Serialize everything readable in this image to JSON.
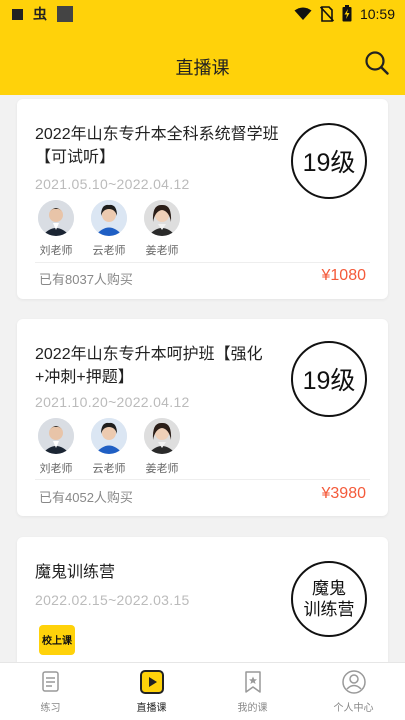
{
  "status_bar": {
    "time": "10:59",
    "bug_glyph": "虫"
  },
  "header": {
    "title": "直播课"
  },
  "courses": [
    {
      "title": "2022年山东专升本全科系统督学班【可试听】",
      "dates": "2021.05.10~2022.04.12",
      "level": "19级",
      "teachers": [
        "刘老师",
        "云老师",
        "姜老师"
      ],
      "buyers": "已有8037人购买",
      "price": "¥1080"
    },
    {
      "title": "2022年山东专升本呵护班【强化+冲刺+押题】",
      "dates": "2021.10.20~2022.04.12",
      "level": "19级",
      "teachers": [
        "刘老师",
        "云老师",
        "姜老师"
      ],
      "buyers": "已有4052人购买",
      "price": "¥3980"
    },
    {
      "title": "魔鬼训练营",
      "dates": "2022.02.15~2022.03.15",
      "level_line1": "魔鬼",
      "level_line2": "训练营",
      "logo_text": "校上课"
    }
  ],
  "tabs": [
    {
      "label": "练习",
      "icon": "practice-icon"
    },
    {
      "label": "直播课",
      "icon": "live-class-icon"
    },
    {
      "label": "我的课",
      "icon": "my-courses-icon"
    },
    {
      "label": "个人中心",
      "icon": "profile-icon"
    }
  ],
  "colors": {
    "brand_yellow": "#ffd20a",
    "price_red": "#f45a3a"
  }
}
